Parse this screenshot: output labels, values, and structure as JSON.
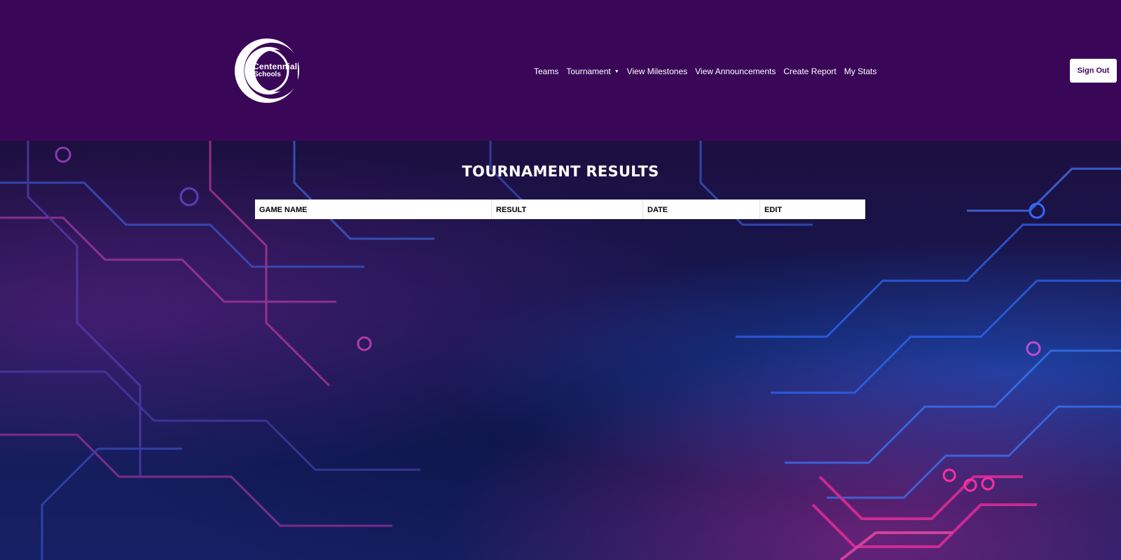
{
  "logo": {
    "line1": "Centennial",
    "line2": "Schools"
  },
  "nav": {
    "items": [
      {
        "label": "Teams"
      },
      {
        "label": "Tournament",
        "dropdown": true
      },
      {
        "label": "View Milestones"
      },
      {
        "label": "View Announcements"
      },
      {
        "label": "Create Report"
      },
      {
        "label": "My Stats"
      }
    ]
  },
  "signout_label": "Sign Out",
  "page_title": "TOURNAMENT RESULTS",
  "table": {
    "headers": [
      "GAME NAME",
      "RESULT",
      "DATE",
      "EDIT"
    ]
  },
  "colors": {
    "header_bg": "#3a0758",
    "accent_pink": "#ff2fa0",
    "accent_blue": "#2f6bff"
  }
}
